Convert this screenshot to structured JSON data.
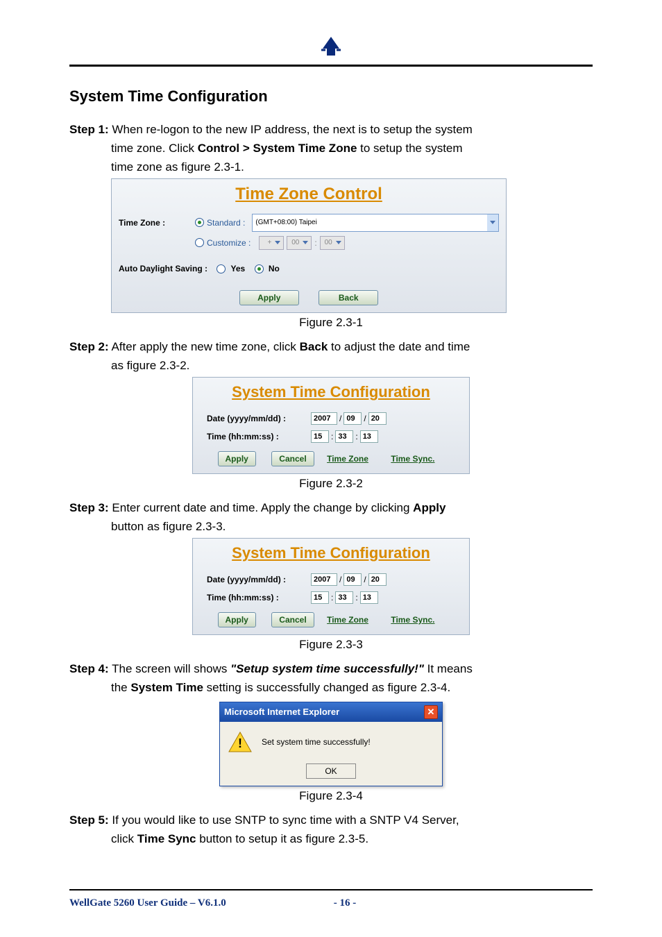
{
  "title": "System Time Configuration",
  "steps": {
    "s1_label": "Step 1:",
    "s1_a": " When re-logon to the new IP address, the next is to setup the system",
    "s1_b": "time zone. Click ",
    "s1_bold": "Control > System Time Zone",
    "s1_c": " to setup the system",
    "s1_d": "time zone as figure 2.3-1.",
    "s2_label": "Step 2:",
    "s2_a": " After apply the new time zone, click ",
    "s2_bold": "Back",
    "s2_b": " to adjust the date and time",
    "s2_c": "as figure 2.3-2.",
    "s3_label": "Step 3:",
    "s3_a": " Enter current date and time. Apply the change by clicking ",
    "s3_bold": "Apply",
    "s3_b": "button as figure 2.3-3.",
    "s4_label": "Step 4:",
    "s4_a": " The screen will shows ",
    "s4_ital": "\"Setup system time successfully!\"",
    "s4_b": " It means",
    "s4_c": "the ",
    "s4_bold": "System Time",
    "s4_d": " setting is successfully changed as figure 2.3-4.",
    "s5_label": "Step 5:",
    "s5_a": " If you would like to use SNTP to sync time with a SNTP V4 Server,",
    "s5_b": "click ",
    "s5_bold": "Time Sync",
    "s5_c": " button to setup it as figure 2.3-5."
  },
  "fig1": {
    "panel_title": "Time Zone Control",
    "tz_label": "Time Zone :",
    "standard_label": "Standard :",
    "customize_label": "Customize :",
    "standard_value": "(GMT+08:00) Taipei",
    "cust_sign": "+",
    "cust_h": "00",
    "cust_m": "00",
    "ads_label": "Auto Daylight Saving :",
    "yes": "Yes",
    "no": "No",
    "apply": "Apply",
    "back": "Back",
    "caption": "Figure 2.3-1"
  },
  "stc": {
    "panel_title": "System Time Configuration",
    "date_label": "Date (yyyy/mm/dd) :",
    "time_label": "Time (hh:mm:ss) :",
    "year": "2007",
    "mon": "09",
    "day": "20",
    "hh": "15",
    "mm": "33",
    "ss": "13",
    "slash": "/",
    "colon": ":",
    "apply": "Apply",
    "cancel": "Cancel",
    "timezone": "Time Zone",
    "timesync": "Time Sync.",
    "caption2": "Figure 2.3-2",
    "caption3": "Figure 2.3-3"
  },
  "dlg": {
    "title": "Microsoft Internet Explorer",
    "msg": "Set system time successfully!",
    "ok": "OK",
    "caption": "Figure 2.3-4"
  },
  "footer": {
    "guide": "WellGate 5260 User Guide – V6.1.0",
    "page": "- 16 -"
  }
}
